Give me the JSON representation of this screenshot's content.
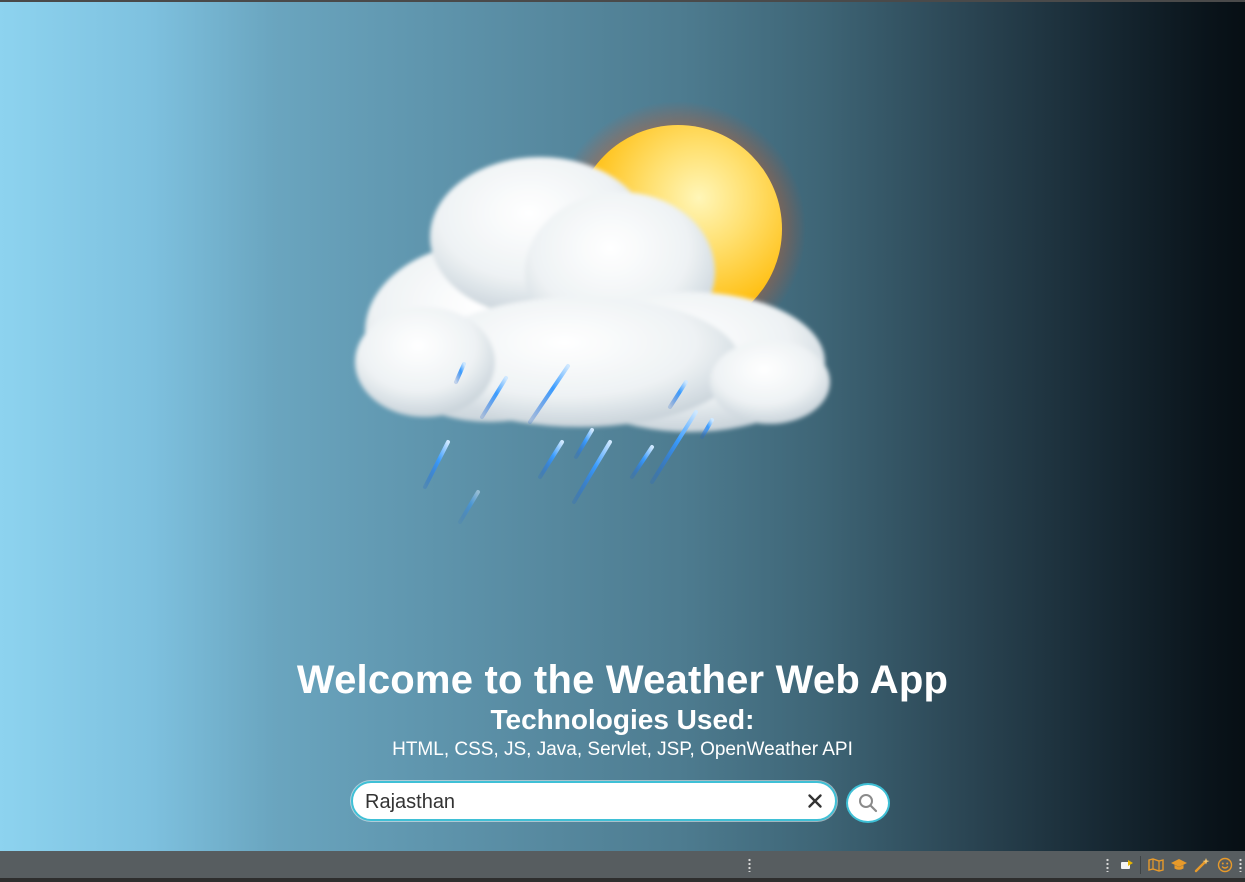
{
  "page": {
    "title": "Welcome to the Weather Web App",
    "subtitle": "Technologies Used:",
    "technologies": "HTML, CSS, JS, Java, Servlet, JSP, OpenWeather API"
  },
  "search": {
    "value": "Rajasthan"
  },
  "icons": {
    "hero": "sun-behind-rain-cloud-illustration",
    "clear": "close-icon",
    "search": "search-icon"
  },
  "colors": {
    "accent": "#3fc0d6",
    "sun": "#ffc21a",
    "rain": "#3a9cff",
    "statusbar": "#575d60",
    "statusbar_icons": "#e89a2a"
  }
}
